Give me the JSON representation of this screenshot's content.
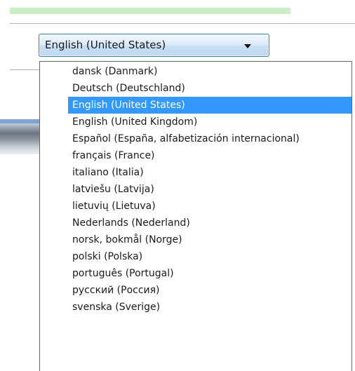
{
  "progress": {
    "fraction": 1.0,
    "color": "#cbedc6"
  },
  "language_combo": {
    "selected_value": "English (United States)",
    "arrow_icon": "chevron-down-icon"
  },
  "language_options": [
    "dansk (Danmark)",
    "Deutsch (Deutschland)",
    "English (United States)",
    "English (United Kingdom)",
    "Español (España, alfabetización internacional)",
    "français (France)",
    "italiano (Italia)",
    "latviešu (Latvija)",
    "lietuvių (Lietuva)",
    "Nederlands (Nederland)",
    "norsk, bokmål (Norge)",
    "polski (Polska)",
    "português (Portugal)",
    "русский (Россия)",
    "svenska (Sverige)"
  ],
  "selected_index": 2,
  "colors": {
    "selection_highlight": "#3399ff",
    "combo_border": "#3c7fb1"
  }
}
